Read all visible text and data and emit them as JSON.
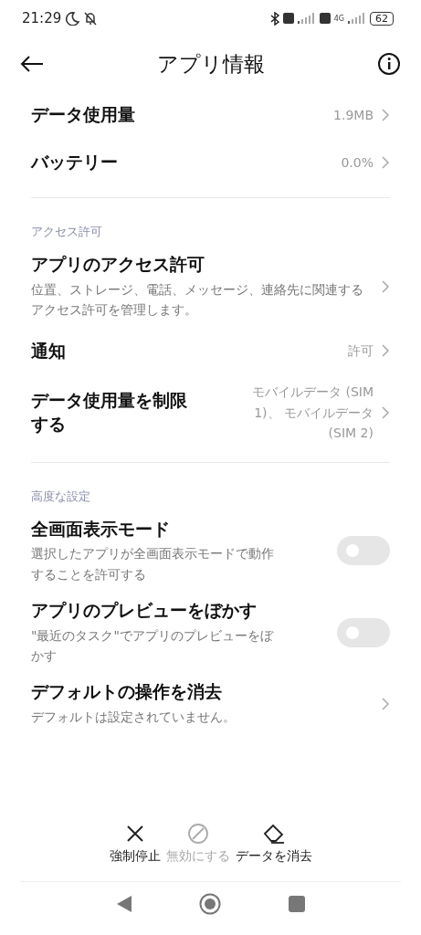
{
  "status_bar": {
    "time": "21:29",
    "network": "4G",
    "battery": "62"
  },
  "header": {
    "title": "アプリ情報"
  },
  "sections": [
    {
      "items": [
        {
          "kind": "link",
          "title": "データ使用量",
          "value": "1.9MB"
        },
        {
          "kind": "link",
          "title": "バッテリー",
          "value": "0.0%"
        }
      ]
    },
    {
      "header": "アクセス許可",
      "items": [
        {
          "kind": "link",
          "title": "アプリのアクセス許可",
          "description": "位置、ストレージ、電話、メッセージ、連絡先に関連するアクセス許可を管理します。"
        },
        {
          "kind": "link",
          "title": "通知",
          "value": "許可"
        },
        {
          "kind": "link",
          "title": "データ使用量を制限する",
          "value": "モバイルデータ (SIM 1)、 モバイルデータ (SIM 2)"
        }
      ]
    },
    {
      "header": "高度な設定",
      "items": [
        {
          "kind": "toggle",
          "title": "全画面表示モード",
          "description": "選択したアプリが全画面表示モードで動作することを許可する",
          "on": false
        },
        {
          "kind": "toggle",
          "title": "アプリのプレビューをぼかす",
          "description": "\"最近のタスク\"でアプリのプレビューをぼかす",
          "on": false
        },
        {
          "kind": "link",
          "title": "デフォルトの操作を消去",
          "description": "デフォルトは設定されていません。"
        }
      ]
    }
  ],
  "actions": [
    {
      "kind": "stop",
      "label": "強制停止",
      "disabled": false
    },
    {
      "kind": "disable",
      "label": "無効にする",
      "disabled": true
    },
    {
      "kind": "clear",
      "label": "データを消去",
      "disabled": false
    }
  ]
}
